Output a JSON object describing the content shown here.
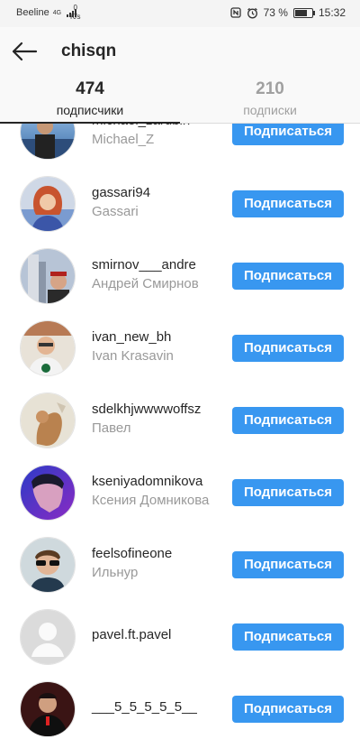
{
  "status_bar": {
    "carrier": "Beeline",
    "network": "4G",
    "speed_value": "0",
    "speed_unit": "K/s",
    "battery_percent": "73 %",
    "time": "15:32",
    "battery_level": 0.73
  },
  "header": {
    "title": "chisqn"
  },
  "tabs": [
    {
      "count": "474",
      "label": "подписчики",
      "active": true
    },
    {
      "count": "210",
      "label": "подписки",
      "active": false
    }
  ],
  "button_label": "Подписаться",
  "users": [
    {
      "username": "michael_zardbin",
      "fullname": "Michael_Z",
      "avatar": "photo"
    },
    {
      "username": "gassari94",
      "fullname": "Gassari",
      "avatar": "photo"
    },
    {
      "username": "smirnov___andre",
      "fullname": "Андрей Смирнов",
      "avatar": "photo"
    },
    {
      "username": "ivan_new_bh",
      "fullname": "Ivan Krasavin",
      "avatar": "photo"
    },
    {
      "username": "sdelkhjwwwwoffsz",
      "fullname": "Павел",
      "avatar": "photo"
    },
    {
      "username": "kseniyadomnikova",
      "fullname": "Ксения Домникова",
      "avatar": "photo"
    },
    {
      "username": "feelsofineone",
      "fullname": "Ильнур",
      "avatar": "photo"
    },
    {
      "username": "pavel.ft.pavel",
      "fullname": "",
      "avatar": "default-person-icon"
    },
    {
      "username": "___5_5_5_5_5__",
      "fullname": "",
      "avatar": "photo"
    }
  ],
  "colors": {
    "accent": "#3897f0",
    "text": "#262626",
    "secondary": "#999999"
  }
}
